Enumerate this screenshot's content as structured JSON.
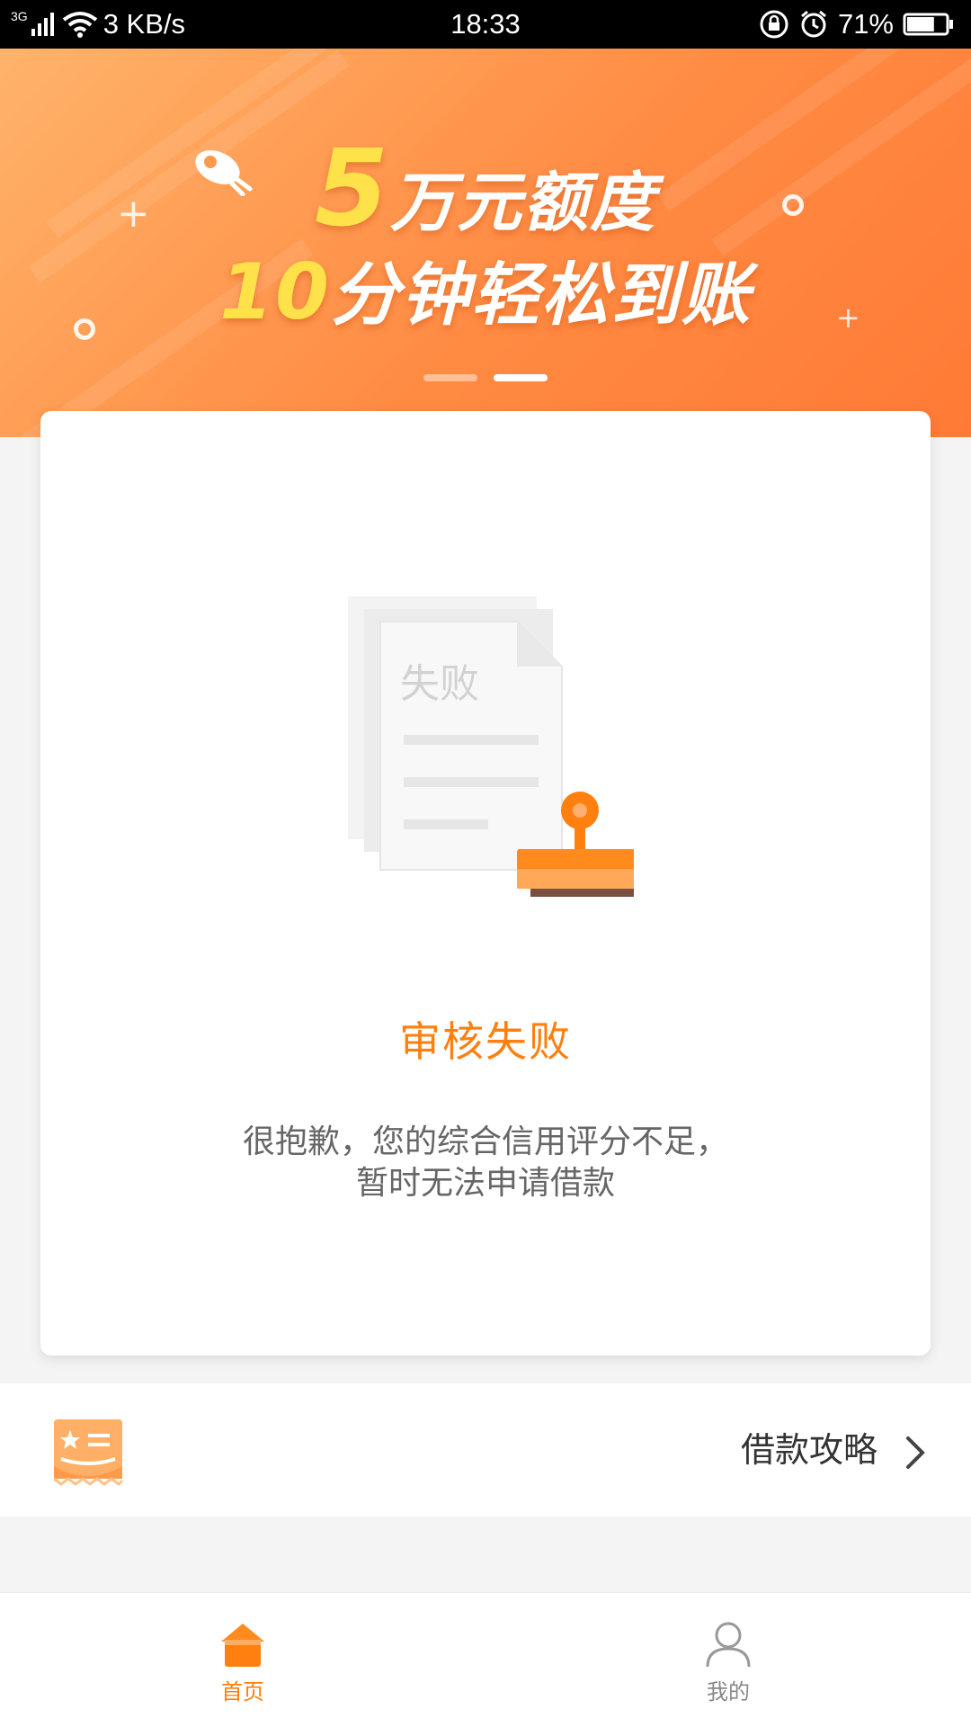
{
  "status_bar": {
    "network_type": "3G",
    "speed": "3 KB/s",
    "time": "18:33",
    "battery": "71%",
    "battery_level": 0.71
  },
  "banner": {
    "line1_num": "5",
    "line1_text": "万元额度",
    "line2_num": "10",
    "line2_text": "分钟轻松到账",
    "active_slide": 2,
    "slide_count": 2
  },
  "result": {
    "stamp_text": "失败",
    "title": "审核失败",
    "desc_line1": "很抱歉，您的综合信用评分不足，",
    "desc_line2": "暂时无法申请借款"
  },
  "guide": {
    "label": "借款攻略"
  },
  "tabs": [
    {
      "label": "首页",
      "icon": "home-icon",
      "active": true
    },
    {
      "label": "我的",
      "icon": "user-icon",
      "active": false
    }
  ],
  "colors": {
    "accent": "#ff7f0f",
    "banner_start": "#ffb36a",
    "banner_end": "#ff7a35",
    "number_yellow": "#ffe14a"
  }
}
